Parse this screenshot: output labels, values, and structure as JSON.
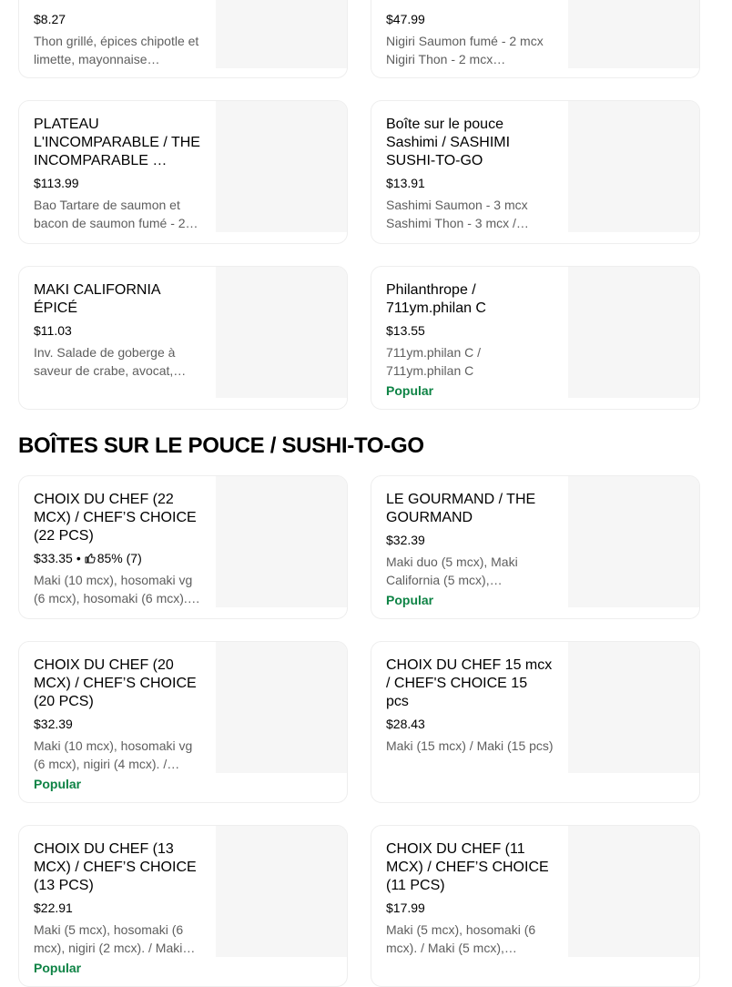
{
  "cards_top": [
    {
      "title": "",
      "price": "$8.27",
      "desc": "Thon grillé, épices chipotle et limette, mayonnaise…",
      "badge": ""
    },
    {
      "title": "",
      "price": "$47.99",
      "desc": "Nigiri Saumon fumé - 2 mcx Nigiri Thon - 2 mcx…",
      "badge": ""
    },
    {
      "title": "PLATEAU L'INCOMPARABLE / THE INCOMPARABLE …",
      "price": "$113.99",
      "desc": "Bao Tartare de saumon et bacon de saumon fumé - 2…",
      "badge": ""
    },
    {
      "title": "Boîte sur le pouce Sashimi  / SASHIMI SUSHI-TO-GO",
      "price": "$13.91",
      "desc": "Sashimi Saumon - 3 mcx Sashimi Thon - 3 mcx /…",
      "badge": ""
    },
    {
      "title": "MAKI CALIFORNIA ÉPICÉ",
      "price": "$11.03",
      "desc": "Inv. Salade de goberge à saveur de crabe, avocat,…",
      "badge": ""
    },
    {
      "title": "Philanthrope / 711ym.philan C",
      "price": "$13.55",
      "desc": "711ym.philan C / 711ym.philan C",
      "badge": "Popular"
    }
  ],
  "section": {
    "title": "BOÎTES SUR LE POUCE / SUSHI-TO-GO"
  },
  "cards_section": [
    {
      "title": "CHOIX DU CHEF (22 MCX) / CHEF’S CHOICE (22 PCS)",
      "price": "$33.35",
      "separator": "•",
      "rating": "85% (7)",
      "desc": "Maki (10 mcx), hosomaki vg (6 mcx), hosomaki (6 mcx).…",
      "badge": ""
    },
    {
      "title": "LE GOURMAND  / THE GOURMAND",
      "price": "$32.39",
      "desc": "Maki duo (5 mcx), Maki California (5 mcx),…",
      "badge": "Popular"
    },
    {
      "title": "CHOIX DU CHEF (20 MCX) / CHEF’S CHOICE (20 PCS)",
      "price": "$32.39",
      "desc": "Maki (10 mcx), hosomaki vg (6 mcx), nigiri (4 mcx). /…",
      "badge": "Popular"
    },
    {
      "title": "CHOIX DU CHEF 15 mcx / CHEF'S CHOICE 15 pcs",
      "price": "$28.43",
      "desc": "Maki (15 mcx) / Maki (15 pcs)",
      "badge": ""
    },
    {
      "title": "CHOIX DU CHEF (13 MCX) / CHEF’S CHOICE (13 PCS)",
      "price": "$22.91",
      "desc": "Maki (5 mcx), hosomaki (6 mcx), nigiri (2 mcx). / Maki…",
      "badge": "Popular"
    },
    {
      "title": "CHOIX DU CHEF (11 MCX) / CHEF’S CHOICE (11 PCS)",
      "price": "$17.99",
      "desc": "Maki (5 mcx), hosomaki (6 mcx). / Maki (5 mcx),…",
      "badge": ""
    }
  ],
  "icons": {
    "rating": "thumbs-up-icon"
  },
  "colors": {
    "popular": "#0e8345",
    "description": "#5e5e5e",
    "thumb": "#f6f6f6"
  }
}
